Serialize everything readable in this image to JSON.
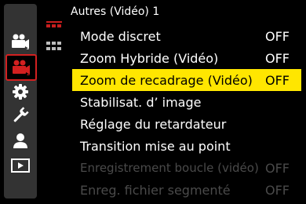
{
  "title": "Autres (Vidéo) 1",
  "colors": {
    "accent": "#d22020",
    "highlight": "#ffe600",
    "disabled": "#4a4a4a"
  },
  "sidebar": [
    {
      "icon": "camera-custom-icon",
      "active": false
    },
    {
      "icon": "video-camera-icon",
      "active": true
    },
    {
      "icon": "gear-icon",
      "active": false
    },
    {
      "icon": "wrench-icon",
      "active": false
    },
    {
      "icon": "user-icon",
      "active": false
    },
    {
      "icon": "play-icon",
      "active": false
    }
  ],
  "subtabs": [
    {
      "icon": "page-1-tab-icon",
      "active": true
    },
    {
      "icon": "page-2-tab-icon",
      "active": false
    }
  ],
  "menu": [
    {
      "label": "Mode discret",
      "value": "OFF",
      "state": "normal"
    },
    {
      "label": "Zoom Hybride (Vidéo)",
      "value": "OFF",
      "state": "normal"
    },
    {
      "label": "Zoom de recadrage (Vidéo)",
      "value": "OFF",
      "state": "selected"
    },
    {
      "label": "Stabilisat. d’ image",
      "value": "",
      "state": "normal"
    },
    {
      "label": "Réglage du retardateur",
      "value": "",
      "state": "normal"
    },
    {
      "label": "Transition mise au point",
      "value": "",
      "state": "normal"
    },
    {
      "label": "Enregistrement boucle (vidéo)",
      "value": "OFF",
      "state": "disabled"
    },
    {
      "label": "Enreg. fichier segmenté",
      "value": "OFF",
      "state": "disabled"
    }
  ]
}
